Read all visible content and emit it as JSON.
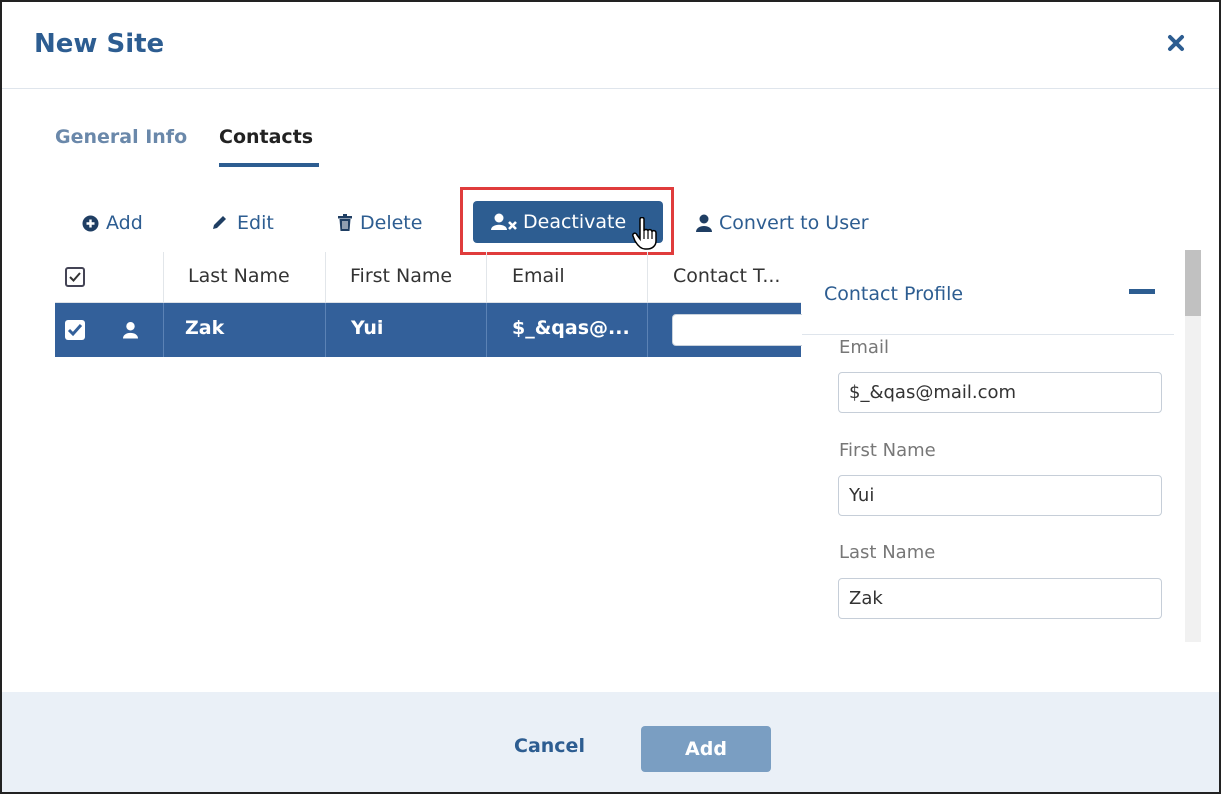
{
  "dialog": {
    "title": "New Site"
  },
  "tabs": [
    {
      "label": "General Info",
      "active": false
    },
    {
      "label": "Contacts",
      "active": true
    }
  ],
  "toolbar": {
    "add": "Add",
    "edit": "Edit",
    "delete": "Delete",
    "deactivate": "Deactivate",
    "convert": "Convert to User"
  },
  "grid": {
    "columns": [
      "Last Name",
      "First Name",
      "Email",
      "Contact T..."
    ],
    "rows": [
      {
        "selected": true,
        "last_name": "Zak",
        "first_name": "Yui",
        "email": "$_&qas@...",
        "contact_type": ""
      }
    ]
  },
  "profile": {
    "title": "Contact Profile",
    "email_label": "Email",
    "email_value": "$_&qas@mail.com",
    "first_name_label": "First Name",
    "first_name_value": "Yui",
    "last_name_label": "Last Name",
    "last_name_value": "Zak"
  },
  "footer": {
    "cancel": "Cancel",
    "add": "Add"
  },
  "colors": {
    "primary": "#2d5d91",
    "selected_row": "#33609a",
    "highlight": "#e03c3c",
    "footer_bg": "#eaf0f7",
    "add_disabled": "#7a9ec2"
  }
}
